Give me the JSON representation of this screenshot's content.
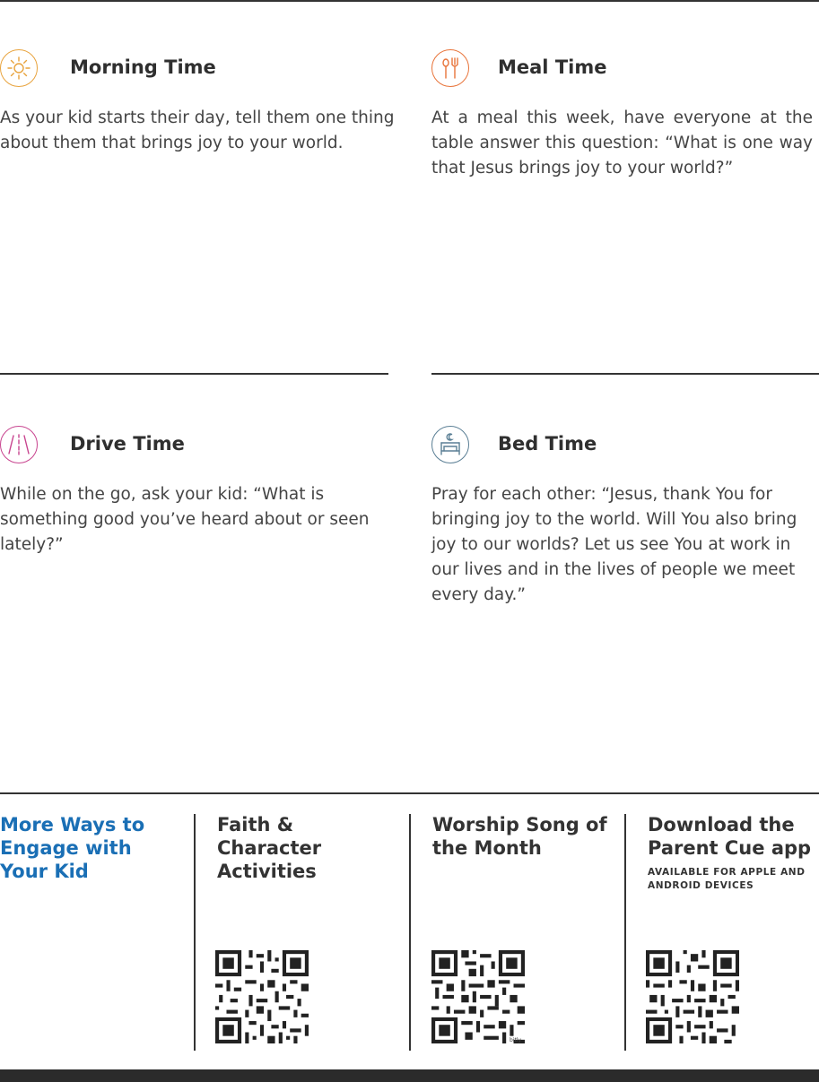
{
  "sections": {
    "morning": {
      "title": "Morning Time",
      "text": "As your kid starts their day, tell them one thing about them that brings joy to your world.",
      "icon": "sun-icon",
      "color": "#e8a33d"
    },
    "meal": {
      "title": "Meal Time",
      "text": "At a meal this week, have everyone at the table answer this question: “What is one way that Jesus brings joy to your world?”",
      "icon": "fork-spoon-icon",
      "color": "#e8743a"
    },
    "drive": {
      "title": "Drive Time",
      "text": "While on the go, ask your kid: “What is something good you’ve heard about or seen lately?”",
      "icon": "road-icon",
      "color": "#c8448f"
    },
    "bed": {
      "title": "Bed Time",
      "text": "Pray for each other: “Jesus, thank You for bringing joy to the world. Will You also bring joy to our worlds? Let us see You at work in our lives and in the lives of people we meet every day.”",
      "icon": "bed-moon-icon",
      "color": "#5b7f95"
    }
  },
  "footer": {
    "engage_title": "More Ways to Engage with Your Kid",
    "engage_color": "#1a6fb5",
    "faith_title": "Faith & Character Activities",
    "worship_title": "Worship Song of the Month",
    "worship_qr_caption": "bitly",
    "app_title": "Download the Parent Cue app",
    "app_subtitle": "AVAILABLE FOR APPLE AND ANDROID DEVICES"
  }
}
